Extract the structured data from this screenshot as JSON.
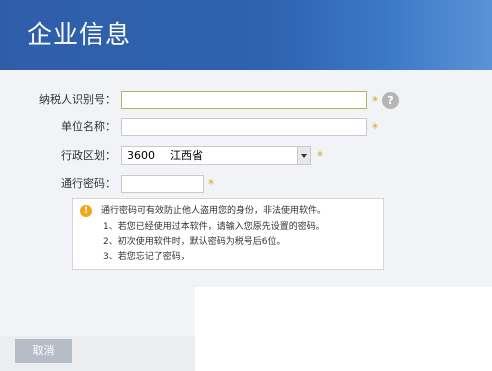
{
  "header": {
    "title": "企业信息"
  },
  "form": {
    "taxpayer_id": {
      "label": "纳税人识别号：",
      "value": "",
      "required": "*",
      "help": "?"
    },
    "company_name": {
      "label": "单位名称：",
      "value": "",
      "required": "*"
    },
    "region": {
      "label": "行政区划：",
      "code": "3600",
      "name": "江西省",
      "required": "*"
    },
    "password": {
      "label": "通行密码：",
      "value": "",
      "required": "*"
    }
  },
  "note": {
    "icon": "!",
    "lines": [
      "通行密码可有效防止他人盗用您的身份，非法使用软件。",
      "1、若您已经使用过本软件，请输入您原先设置的密码。",
      "2、初次使用软件时，默认密码为税号后6位。",
      "3、若您忘记了密码，"
    ]
  },
  "footer": {
    "cancel_label": "取消"
  },
  "colors": {
    "header_blue": "#2f5ea9",
    "required_star": "#e0a21d",
    "warning": "#f0a817"
  }
}
